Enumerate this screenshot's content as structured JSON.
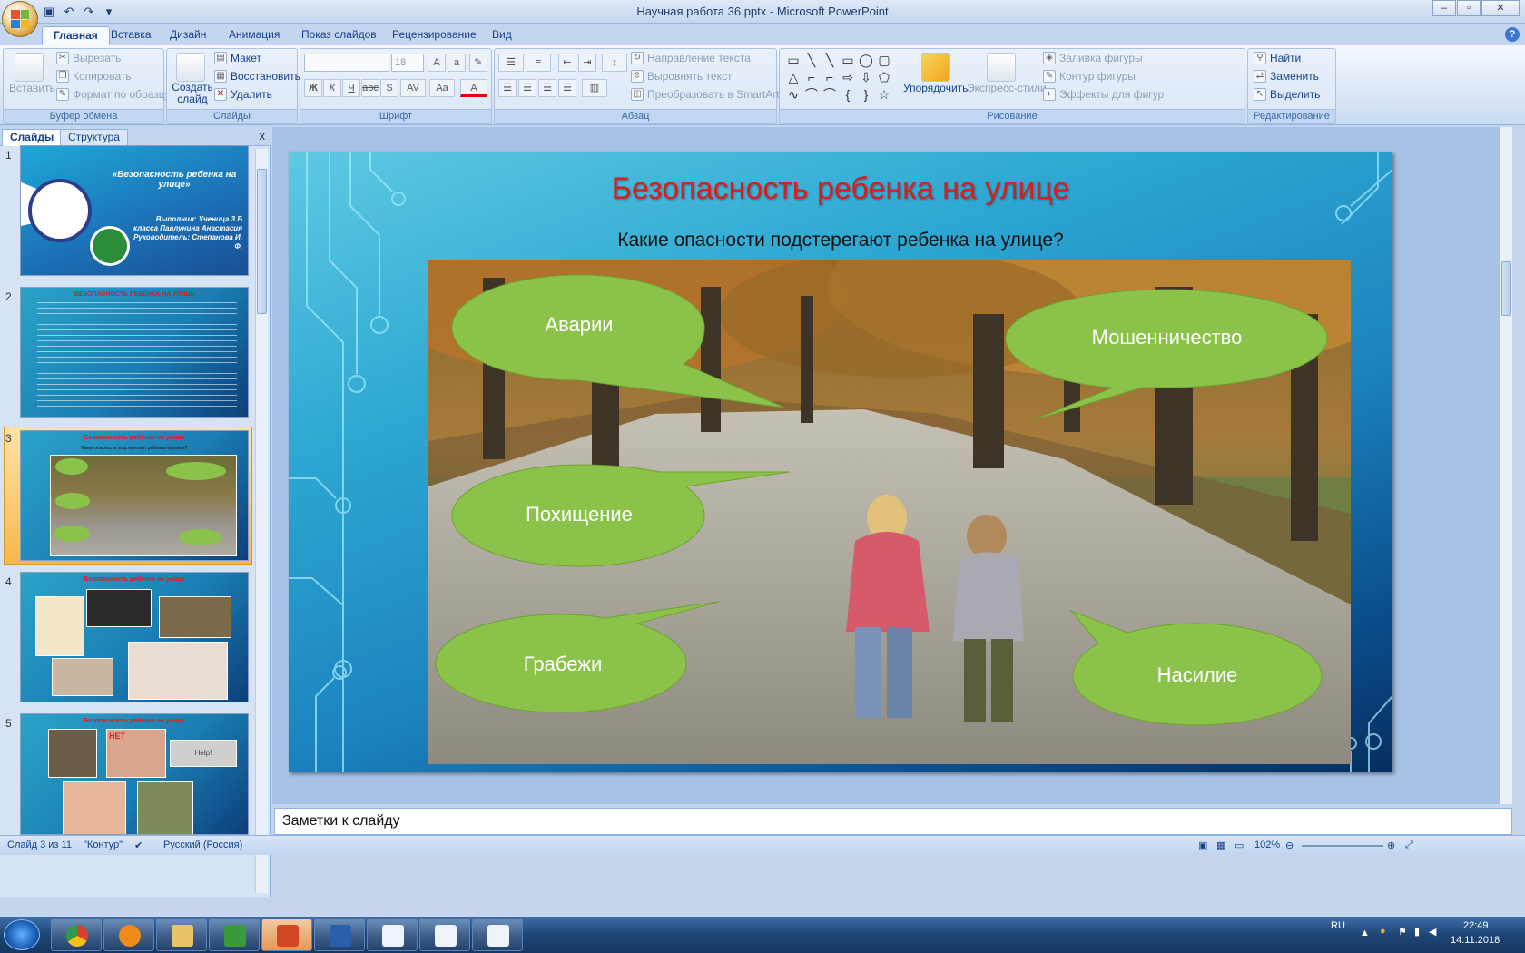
{
  "window": {
    "title": "Научная работа 36.pptx - Microsoft PowerPoint"
  },
  "tabs": [
    "Главная",
    "Вставка",
    "Дизайн",
    "Анимация",
    "Показ слайдов",
    "Рецензирование",
    "Вид"
  ],
  "ribbon": {
    "clipboard": {
      "paste": "Вставить",
      "cut": "Вырезать",
      "copy": "Копировать",
      "format": "Формат по образцу",
      "label": "Буфер обмена"
    },
    "slides": {
      "create": "Создать слайд",
      "layout": "Макет",
      "reset": "Восстановить",
      "delete": "Удалить",
      "label": "Слайды"
    },
    "font": {
      "size": "18",
      "label": "Шрифт"
    },
    "paragraph": {
      "direction": "Направление текста",
      "align": "Выровнять текст",
      "smartart": "Преобразовать в SmartArt",
      "label": "Абзац"
    },
    "drawing": {
      "arrange": "Упорядочить",
      "styles": "Экспресс-стили",
      "fill": "Заливка фигуры",
      "outline": "Контур фигуры",
      "effects": "Эффекты для фигур",
      "label": "Рисование"
    },
    "editing": {
      "find": "Найти",
      "replace": "Заменить",
      "select": "Выделить",
      "label": "Редактирование"
    }
  },
  "panel": {
    "tab_slides": "Слайды",
    "tab_outline": "Структура",
    "close": "x"
  },
  "thumbs": [
    {
      "num": "1",
      "title": "«Безопасность ребенка на улице»",
      "author": "Выполнил: Ученица 3 Б класса Павлунина Анастасия Руководитель: Степанова И. Ф."
    },
    {
      "num": "2",
      "title": "БЕЗОПАСНОСТЬ РЕБЕНКА НА УЛИЦЕ"
    },
    {
      "num": "3",
      "title": "Безопасность ребенка на улице",
      "sub": "Какие опасности подстерегают ребенка на улице?"
    },
    {
      "num": "4",
      "title": "Безопасность ребенка на улице"
    },
    {
      "num": "5",
      "title": "Безопасность ребенка на улице",
      "tag": "НЕТ",
      "help": "Help!"
    }
  ],
  "slide": {
    "title": "Безопасность ребенка на улице",
    "subtitle": "Какие опасности подстерегают ребенка на улице?",
    "bubbles": {
      "b1": "Аварии",
      "b2": "Мошенничество",
      "b3": "Похищение",
      "b4": "Грабежи",
      "b5": "Насилие"
    }
  },
  "notes": {
    "placeholder": "Заметки к слайду"
  },
  "status": {
    "slide": "Слайд 3 из 11",
    "theme": "\"Контур\"",
    "lang": "Русский (Россия)",
    "zoom": "102%"
  },
  "tray": {
    "lang": "RU",
    "time": "22:49",
    "date": "14.11.2018"
  },
  "colors": {
    "title_red": "#d81e1e",
    "bubble_green": "#8bc34a",
    "ribbon_blue": "#c4d6ef"
  }
}
